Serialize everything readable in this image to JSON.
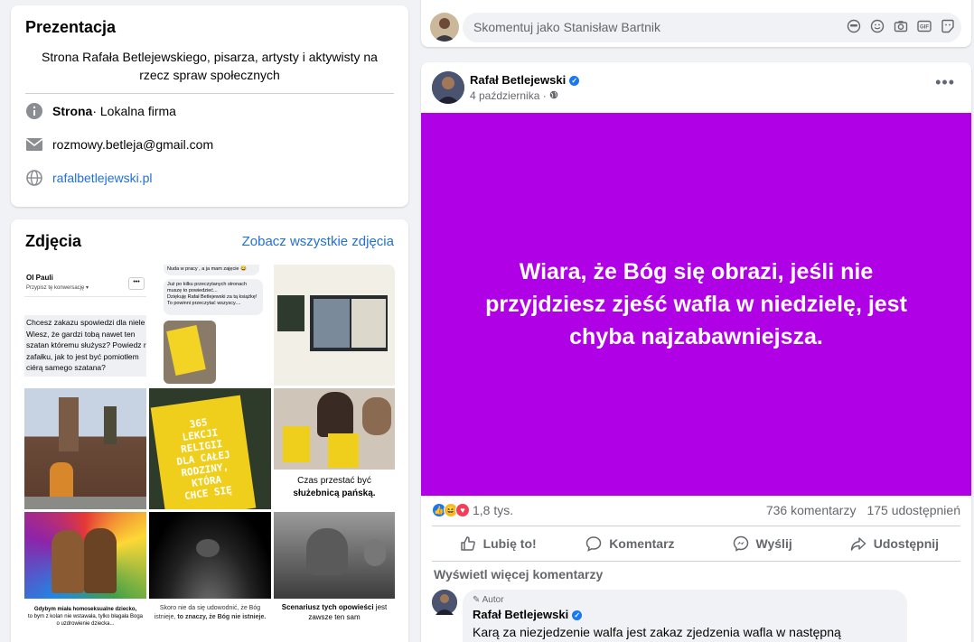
{
  "intro": {
    "title": "Prezentacja",
    "description": "Strona Rafała Betlejewskiego, pisarza, artysty i aktywisty na rzecz spraw społecznych",
    "category_bold": "Strona",
    "category_rest": " · Lokalna firma",
    "email": "rozmowy.betleja@gmail.com",
    "website": "rafalbetlejewski.pl",
    "icons": [
      "info-icon",
      "envelope-icon",
      "globe-icon"
    ]
  },
  "photos": {
    "title": "Zdjęcia",
    "see_all": "Zobacz wszystkie zdjęcia",
    "p1": {
      "name": "OI Pauli",
      "sub": "Przypisz tę konwersację ▾",
      "lines": [
        "Chcesz zakazu spowiedzi dla niele",
        "Wiesz, że gardzi tobą nawet ten",
        "szatan któremu służysz? Powiedz r",
        "zafałku, jak to jest być pomiotłem",
        "ciérą samego szatana?"
      ]
    },
    "p2": {
      "l1": "Nuda w pracy , a ja mam zajęcie 😂",
      "l2": "Już po kilku przeczytanych stronach muszę to powiedzieć...",
      "l3": "Dziękuję Rafał Betlejewski za tą książkę! To powinni przeczytać wszyscy...."
    },
    "p5": {
      "lines": [
        "365",
        "LEKCJI",
        "RELIGII",
        "DLA CAŁEJ",
        "RODZINY,",
        "KTÓRA",
        "CHCE SIĘ"
      ]
    },
    "p6": {
      "l1": "Czas przestać być",
      "l2": "służebnicą pańską."
    },
    "p7": {
      "l1": "Gdybym miała homoseksualne dziecko,",
      "l2": "to bym z kolan nie wstawała, tylko błagała Boga o uzdrowienie dziecka..."
    },
    "p8": {
      "l1": "Skoro nie da się udowodnić, że Bóg istnieje,",
      "l2": "to znaczy, że Bóg nie istnieje."
    },
    "p9": {
      "l1": "Scenariusz tych opowieści",
      "l2": "jest zawsze ten sam"
    }
  },
  "comment_bar": {
    "placeholder": "Skomentuj jako Stanisław Bartnik",
    "tool_icons": [
      "sticker-icon",
      "emoji-icon",
      "camera-icon",
      "gif-icon",
      "avatar-sticker-icon"
    ]
  },
  "post": {
    "author": "Rafał Betlejewski",
    "date": "4 października",
    "date_sep": " · ",
    "more": "•••",
    "text": "Wiara, że Bóg się obrazi, jeśli nie przyjdziesz zjeść wafla w niedzielę, jest chyba najzabawniejsza.",
    "banner_color": "#b000e6",
    "reactions_count": "1,8 tys.",
    "comments_count": "736 komentarzy",
    "shares_count": "175 udostępnień",
    "actions": {
      "like": "Lubię to!",
      "comment": "Komentarz",
      "send": "Wyślij",
      "share": "Udostępnij"
    },
    "more_comments": "Wyświetl więcej komentarzy",
    "comment": {
      "badge": "Autor",
      "author": "Rafał Betlejewski",
      "text": "Karą za niezjedzenie walfa jest zakaz zjedzenia wafla w następną niedzielę. 😀"
    }
  }
}
